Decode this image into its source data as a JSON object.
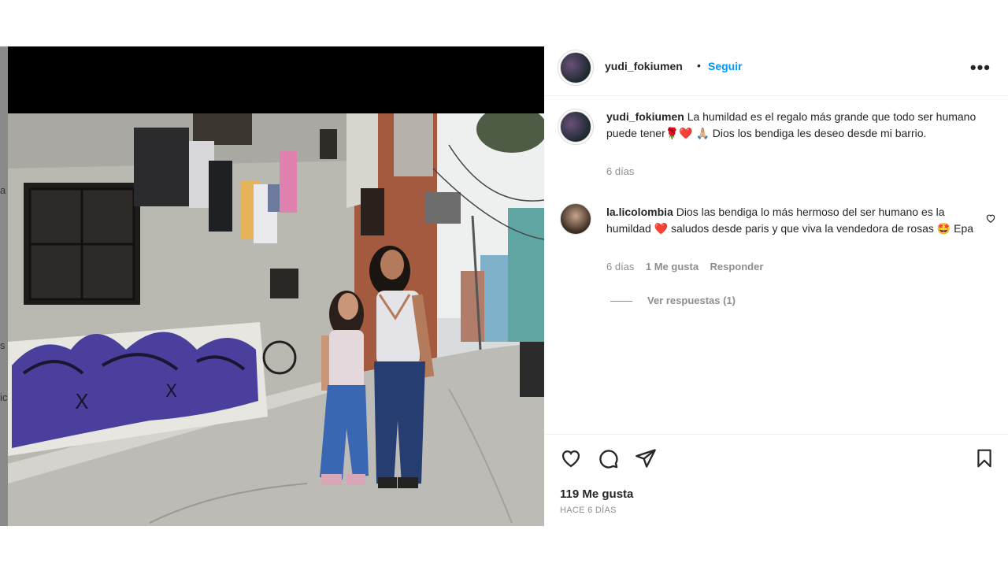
{
  "post": {
    "author": "yudi_fokiumen",
    "follow_label": "Seguir",
    "separator": "•",
    "more_label": "•••"
  },
  "caption": {
    "username": "yudi_fokiumen",
    "text": "La humildad es el regalo más grande que todo ser humano puede tener🌹❤️ 🙏🏼 Dios los bendiga les deseo desde mi barrio.",
    "time": "6 días"
  },
  "comment": {
    "username": "la.licolombia",
    "text": "Dios las bendiga lo más hermoso del ser humano es la humildad ❤️ saludos desde paris y que viva la vendedora de rosas 🤩 Epa",
    "time": "6 días",
    "likes": "1 Me gusta",
    "reply_label": "Responder",
    "view_replies": "Ver respuestas (1)"
  },
  "footer": {
    "likes": "119 Me gusta",
    "ago": "HACE 6 DÍAS"
  },
  "left_strip": {
    "g1": "a",
    "g2": "s",
    "g3": "ic"
  },
  "colors": {
    "accent": "#0095f6",
    "text": "#262626",
    "muted": "#8e8e8e",
    "heart": "#ed4956"
  }
}
